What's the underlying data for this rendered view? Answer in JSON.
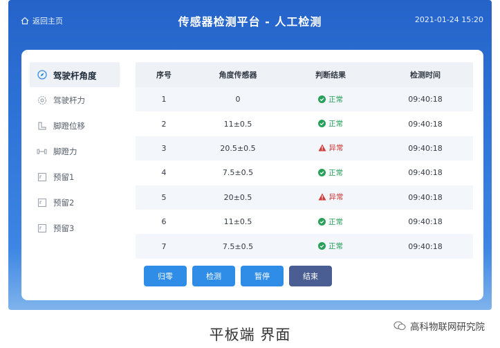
{
  "header": {
    "home_label": "返回主页",
    "title": "传感器检测平台 - 人工检测",
    "datetime": "2021-01-24 15:20"
  },
  "sidebar": {
    "items": [
      {
        "label": "驾驶杆角度",
        "icon": "compass-icon",
        "active": true
      },
      {
        "label": "驾驶杆力",
        "icon": "gear-icon",
        "active": false
      },
      {
        "label": "脚蹬位移",
        "icon": "pedal-icon",
        "active": false
      },
      {
        "label": "脚蹬力",
        "icon": "dumbbell-icon",
        "active": false
      },
      {
        "label": "预留1",
        "icon": "reserve-icon",
        "active": false
      },
      {
        "label": "预留2",
        "icon": "reserve-icon",
        "active": false
      },
      {
        "label": "预留3",
        "icon": "reserve-icon",
        "active": false
      }
    ]
  },
  "table": {
    "headers": [
      "序号",
      "角度传感器",
      "判断结果",
      "检测时间"
    ],
    "rows": [
      {
        "index": "1",
        "value": "0",
        "result": "正常",
        "status": "ok",
        "time": "09:40:18"
      },
      {
        "index": "2",
        "value": "11±0.5",
        "result": "正常",
        "status": "ok",
        "time": "09:40:18"
      },
      {
        "index": "3",
        "value": "20.5±0.5",
        "result": "异常",
        "status": "err",
        "time": "09:40:18"
      },
      {
        "index": "4",
        "value": "7.5±0.5",
        "result": "正常",
        "status": "ok",
        "time": "09:40:18"
      },
      {
        "index": "5",
        "value": "20±0.5",
        "result": "异常",
        "status": "err",
        "time": "09:40:18"
      },
      {
        "index": "6",
        "value": "11±0.5",
        "result": "正常",
        "status": "ok",
        "time": "09:40:18"
      },
      {
        "index": "7",
        "value": "7.5±0.5",
        "result": "正常",
        "status": "ok",
        "time": "09:40:18"
      }
    ]
  },
  "buttons": {
    "zero": "归零",
    "detect": "检测",
    "pause": "暂停",
    "end": "结束"
  },
  "caption": "平板端 界面",
  "watermark": "高科物联网研究院",
  "colors": {
    "primary": "#2f8de8",
    "header_bg": "#2563c9",
    "ok": "#27a05a",
    "err": "#d23a3a",
    "end_button": "#4a5e93"
  }
}
